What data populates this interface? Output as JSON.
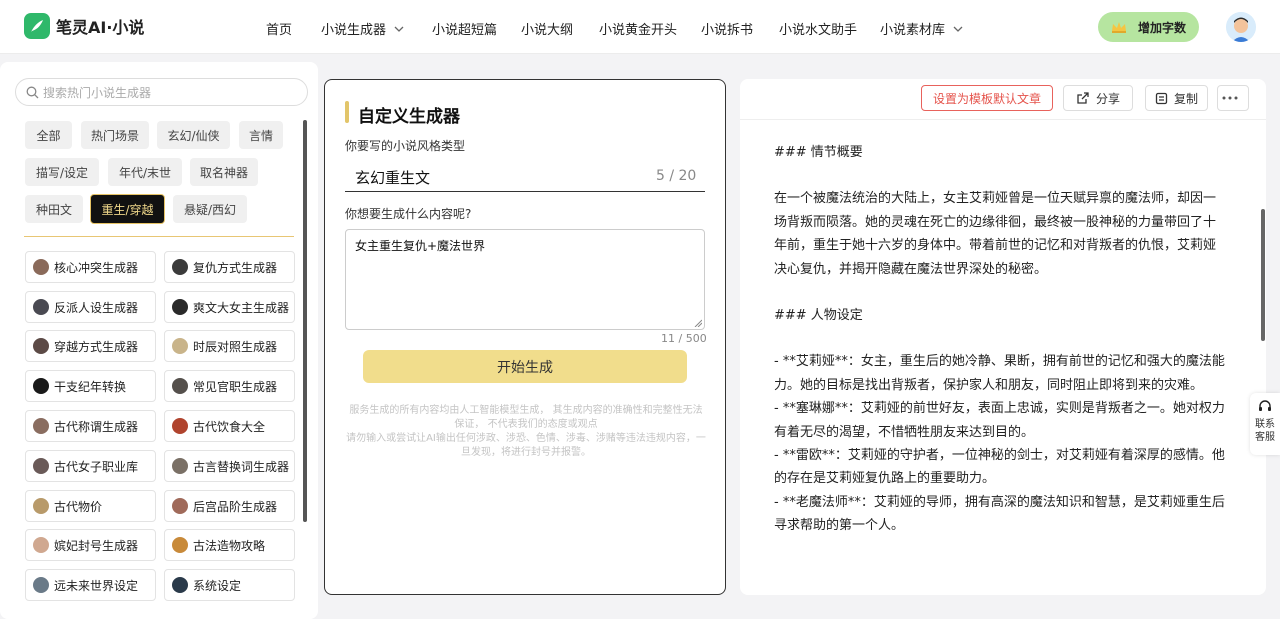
{
  "brand": {
    "name": "笔灵AI·小说"
  },
  "nav": [
    {
      "label": "首页",
      "has_dropdown": false
    },
    {
      "label": "小说生成器",
      "has_dropdown": true
    },
    {
      "label": "小说超短篇",
      "has_dropdown": false
    },
    {
      "label": "小说大纲",
      "has_dropdown": false
    },
    {
      "label": "小说黄金开头",
      "has_dropdown": false
    },
    {
      "label": "小说拆书",
      "has_dropdown": false
    },
    {
      "label": "小说水文助手",
      "has_dropdown": false
    },
    {
      "label": "小说素材库",
      "has_dropdown": true
    }
  ],
  "header": {
    "add_words_label": "增加字数"
  },
  "sidebar": {
    "search_placeholder": "搜索热门小说生成器",
    "tags": [
      "全部",
      "热门场景",
      "玄幻/仙侠",
      "言情",
      "描写/设定",
      "年代/末世",
      "取名神器",
      "种田文",
      "重生/穿越",
      "悬疑/西幻"
    ],
    "active_tag": "重生/穿越",
    "generators": [
      "核心冲突生成器",
      "复仇方式生成器",
      "反派人设生成器",
      "爽文大女主生成器",
      "穿越方式生成器",
      "时辰对照生成器",
      "干支纪年转换",
      "常见官职生成器",
      "古代称谓生成器",
      "古代饮食大全",
      "古代女子职业库",
      "古言替换词生成器",
      "古代物价",
      "后宫品阶生成器",
      "嫔妃封号生成器",
      "古法造物攻略",
      "远未来世界设定",
      "系统设定"
    ]
  },
  "form": {
    "title": "自定义生成器",
    "style_label": "你要写的小说风格类型",
    "style_value": "玄幻重生文",
    "style_count": "5 / 20",
    "content_label": "你想要生成什么内容呢?",
    "content_value": "女主重生复仇+魔法世界",
    "content_count": "11 / 500",
    "submit_label": "开始生成",
    "disclaimer_1": "服务生成的所有内容均由人工智能模型生成， 其生成内容的准确性和完整性无法保证， 不代表我们的态度或观点",
    "disclaimer_2": "请勿输入或尝试让AI输出任何涉政、涉恐、色情、涉毒、涉赌等违法违规内容，一旦发现，将进行封号并报警。"
  },
  "output": {
    "toolbar": {
      "set_default": "设置为模板默认文章",
      "share": "分享",
      "copy": "复制"
    },
    "paragraphs": [
      "### 情节概要",
      "在一个被魔法统治的大陆上，女主艾莉娅曾是一位天赋异禀的魔法师，却因一场背叛而陨落。她的灵魂在死亡的边缘徘徊，最终被一股神秘的力量带回了十年前，重生于她十六岁的身体中。带着前世的记忆和对背叛者的仇恨，艾莉娅决心复仇，并揭开隐藏在魔法世界深处的秘密。",
      "### 人物设定",
      "- **艾莉娅**：女主，重生后的她冷静、果断，拥有前世的记忆和强大的魔法能力。她的目标是找出背叛者，保护家人和朋友，同时阻止即将到来的灾难。",
      "- **塞琳娜**：艾莉娅的前世好友，表面上忠诚，实则是背叛者之一。她对权力有着无尽的渴望，不惜牺牲朋友来达到目的。",
      "- **雷欧**：艾莉娅的守护者，一位神秘的剑士，对艾莉娅有着深厚的感情。他的存在是艾莉娅复仇路上的重要助力。",
      "- **老魔法师**：艾莉娅的导师，拥有高深的魔法知识和智慧，是艾莉娅重生后寻求帮助的第一个人。"
    ]
  },
  "contact": {
    "label": "联系客服"
  },
  "colors": {
    "brand_green": "#2fb86a",
    "gold": "#e2c56a",
    "button_yellow": "#f1dd8c",
    "red": "#e5534b"
  }
}
